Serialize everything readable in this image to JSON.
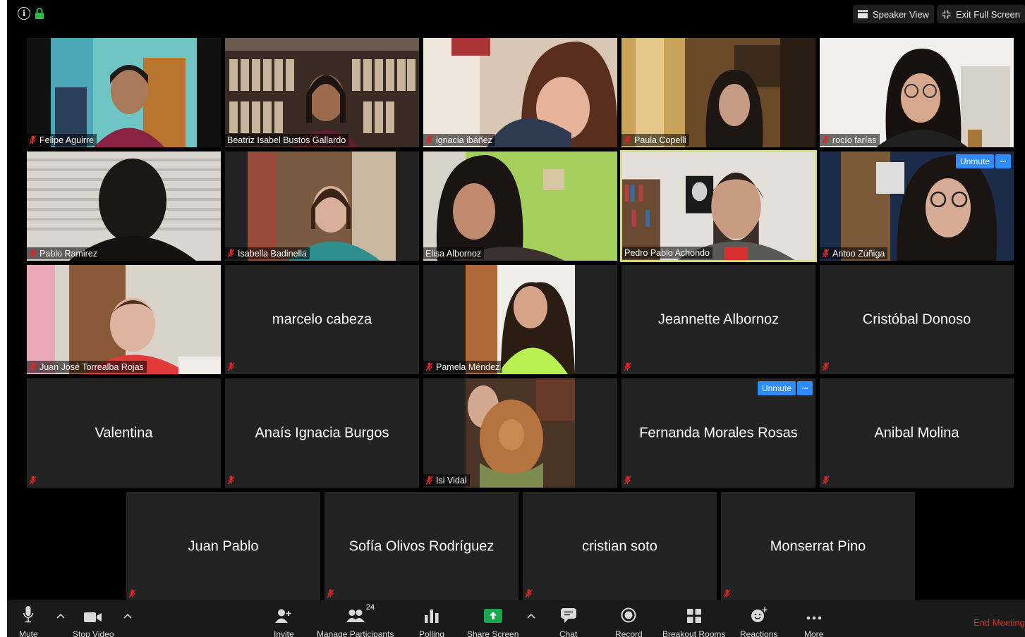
{
  "top_bar": {
    "speaker_view_label": "Speaker View",
    "exit_full_screen_label": "Exit Full Screen"
  },
  "participants": [
    {
      "name": "Felipe Aguirre",
      "video": true,
      "muted": true
    },
    {
      "name": "Beatriz Isabel Bustos Gallardo",
      "video": true,
      "muted": false
    },
    {
      "name": "ignacia ibáñez",
      "video": true,
      "muted": true
    },
    {
      "name": "Paula Copelli",
      "video": true,
      "muted": true
    },
    {
      "name": "rocío farías",
      "video": true,
      "muted": true
    },
    {
      "name": "Pablo Ramirez",
      "video": true,
      "muted": true
    },
    {
      "name": "Isabella Badinella",
      "video": true,
      "muted": true
    },
    {
      "name": "Elisa Albornoz",
      "video": true,
      "muted": false
    },
    {
      "name": "Pedro Pablo Achondo",
      "video": true,
      "muted": false,
      "active_speaker": true
    },
    {
      "name": "Antoo Zúñiga",
      "video": true,
      "muted": true,
      "unmute_label": "Unmute",
      "more_label": "···"
    },
    {
      "name": "Juan José Torrealba Rojas",
      "video": true,
      "muted": true
    },
    {
      "name": "marcelo cabeza",
      "video": false,
      "muted": true
    },
    {
      "name": "Pamela Méndez",
      "video": true,
      "muted": true
    },
    {
      "name": "Jeannette Albornoz",
      "video": false,
      "muted": true
    },
    {
      "name": "Cristóbal Donoso",
      "video": false,
      "muted": true
    },
    {
      "name": "Valentina",
      "video": false,
      "muted": true
    },
    {
      "name": "Anaís Ignacia Burgos",
      "video": false,
      "muted": true
    },
    {
      "name": "Isi Vidal",
      "video": true,
      "muted": true
    },
    {
      "name": "Fernanda Morales Rosas",
      "video": false,
      "muted": true,
      "unmute_label": "Unmute",
      "more_label": "···"
    },
    {
      "name": "Anibal Molina",
      "video": false,
      "muted": true
    },
    {
      "name": "Juan Pablo",
      "video": false,
      "muted": true
    },
    {
      "name": "Sofía Olivos Rodríguez",
      "video": false,
      "muted": true
    },
    {
      "name": "cristian soto",
      "video": false,
      "muted": true
    },
    {
      "name": "Monserrat Pino",
      "video": false,
      "muted": true
    }
  ],
  "toolbar": {
    "mute_label": "Mute",
    "stop_video_label": "Stop Video",
    "invite_label": "Invite",
    "manage_participants_label": "Manage Participants",
    "participant_count": "24",
    "polling_label": "Polling",
    "share_screen_label": "Share Screen",
    "chat_label": "Chat",
    "record_label": "Record",
    "breakout_rooms_label": "Breakout Rooms",
    "reactions_label": "Reactions",
    "more_label": "More",
    "end_meeting_label": "End Meeting"
  },
  "colors": {
    "background": "#000000",
    "tile": "#232323",
    "active_speaker_border": "#d9df6c",
    "unmute_button": "#2d8cff",
    "share_screen_green": "#19a94a",
    "end_meeting": "#e02828",
    "mute_icon": "#d9262a"
  },
  "icons": {
    "info": "info-icon",
    "lock": "lock-icon",
    "speaker_view": "speaker-view-icon",
    "exit_full_screen": "exit-full-screen-icon",
    "muted_indicator": "muted-mic-icon",
    "mic": "microphone-icon",
    "video": "video-camera-icon",
    "invite": "add-person-icon",
    "participants": "participants-icon",
    "polling": "bar-chart-icon",
    "share": "share-screen-icon",
    "chat": "chat-bubble-icon",
    "record": "record-icon",
    "breakout": "grid-icon",
    "reactions": "add-emoji-icon",
    "more": "ellipsis-icon",
    "caret": "chevron-up-icon"
  }
}
